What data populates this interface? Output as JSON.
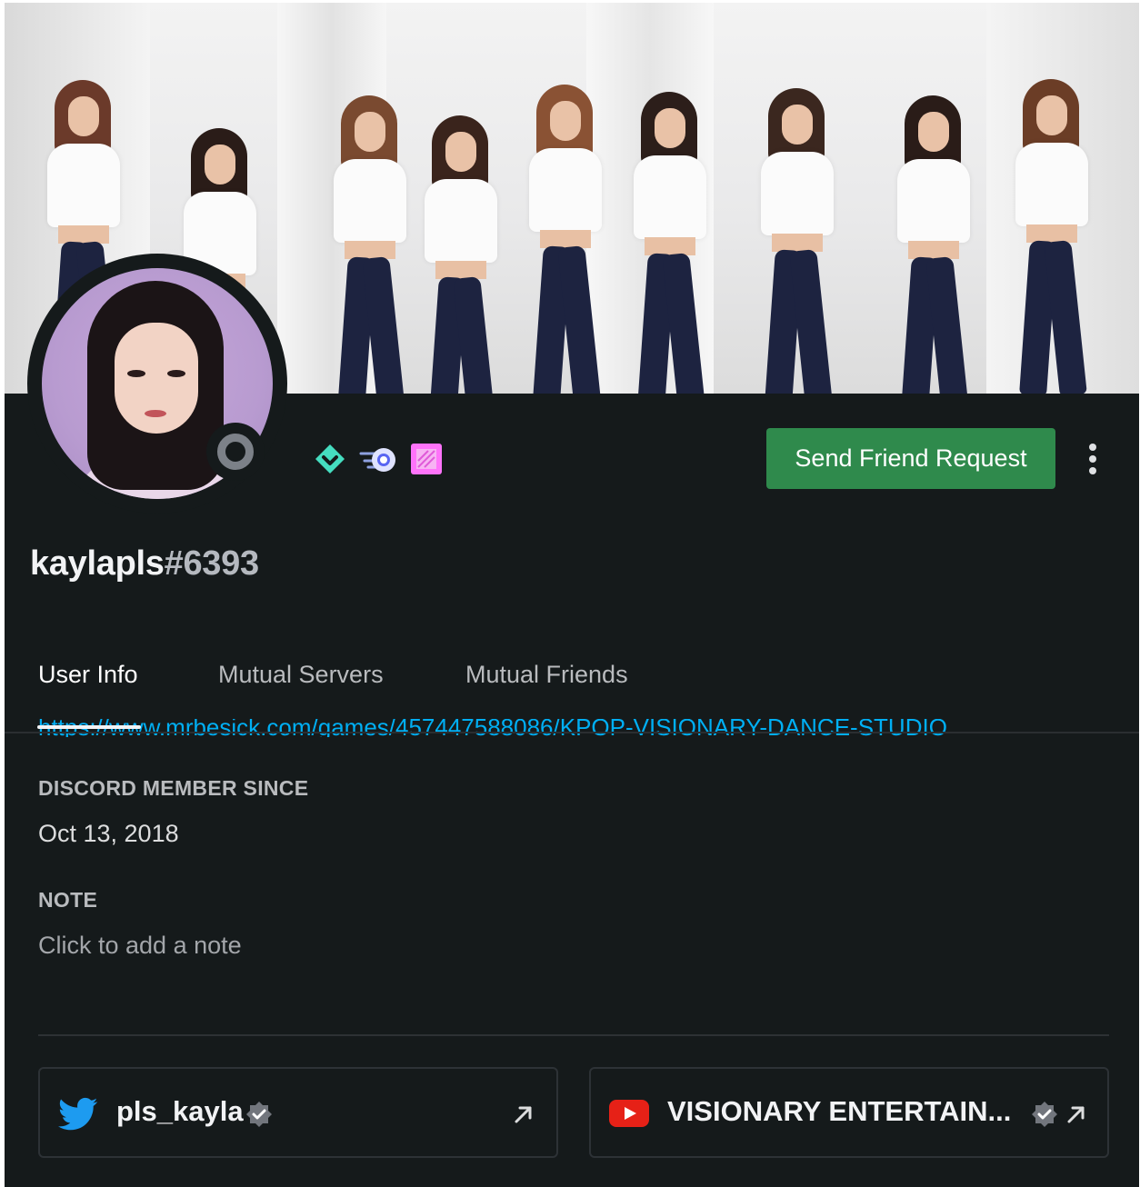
{
  "profile": {
    "username": "kaylapls",
    "discriminator": "#6393",
    "friend_request_label": "Send Friend Request"
  },
  "tabs": [
    {
      "label": "User Info",
      "active": true
    },
    {
      "label": "Mutual Servers",
      "active": false
    },
    {
      "label": "Mutual Friends",
      "active": false
    }
  ],
  "about": {
    "link_partial": "https://www.mrbesick.com/games/457447588086/KPOP-VISIONARY-DANCE-STUDIO"
  },
  "member_since": {
    "label": "DISCORD MEMBER SINCE",
    "value": "Oct 13, 2018"
  },
  "note": {
    "label": "NOTE",
    "placeholder": "Click to add a note"
  },
  "connections": [
    {
      "service": "twitter",
      "name": "pls_kayla",
      "verified": true
    },
    {
      "service": "youtube",
      "name": "VISIONARY ENTERTAIN...",
      "verified": true
    }
  ],
  "colors": {
    "background": "#151a1b",
    "accent_green": "#2f8a4c",
    "twitter_blue": "#1d9bf0",
    "youtube_red": "#e62117",
    "link_blue": "#00aff4"
  },
  "icons": {
    "status": "offline-status-icon",
    "badges": [
      "hypesquad-balance-badge-icon",
      "early-supporter-comet-badge-icon",
      "nitro-boost-badge-icon"
    ],
    "more": "more-vertical-icon",
    "verified": "verified-check-icon",
    "external": "external-link-arrow-icon"
  }
}
